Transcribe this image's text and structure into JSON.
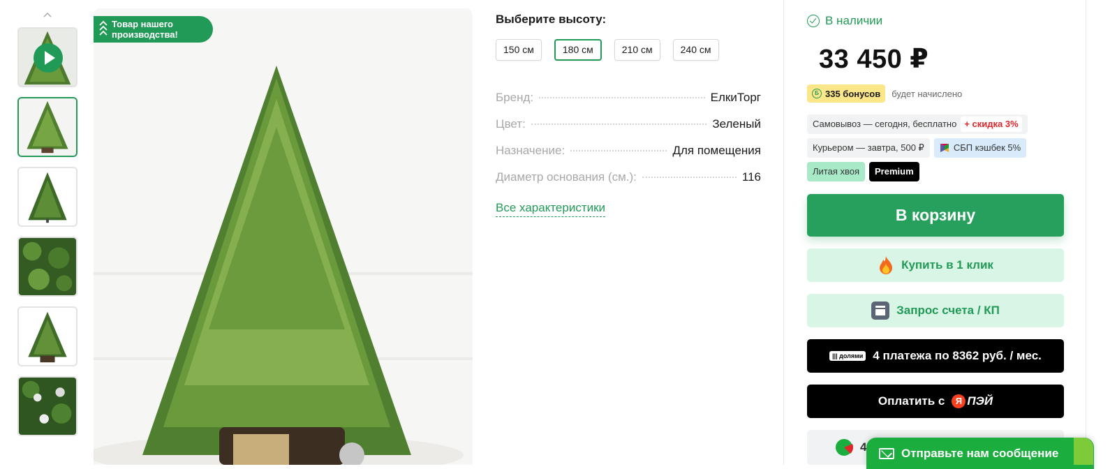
{
  "gallery": {
    "thumbnails": [
      {
        "kind": "video"
      },
      {
        "kind": "image",
        "active": true
      },
      {
        "kind": "image"
      },
      {
        "kind": "image"
      },
      {
        "kind": "image"
      },
      {
        "kind": "image"
      }
    ],
    "promo_badge": "Товар нашего\nпроизводства!"
  },
  "options": {
    "title": "Выберите высоту:",
    "sizes": [
      {
        "label": "150 см",
        "selected": false
      },
      {
        "label": "180 см",
        "selected": true
      },
      {
        "label": "210 см",
        "selected": false
      },
      {
        "label": "240 см",
        "selected": false
      }
    ]
  },
  "specs": {
    "rows": [
      {
        "label": "Бренд:",
        "value": "ЕлкиТорг"
      },
      {
        "label": "Цвет:",
        "value": "Зеленый"
      },
      {
        "label": "Назначение:",
        "value": "Для помещения"
      },
      {
        "label": "Диаметр основания (см.):",
        "value": "116"
      }
    ],
    "all_link": "Все характеристики"
  },
  "buy": {
    "stock": "В наличии",
    "price": "33 450 ₽",
    "bonus": "335 бонусов",
    "bonus_note": "будет начислено",
    "pickup": "Самовывоз — сегодня, бесплатно",
    "pickup_discount": "+ скидка 3%",
    "courier": "Курьером — завтра, 500 ₽",
    "sbp": "СБП кэшбек 5%",
    "tag_needle": "Литая хвоя",
    "tag_premium": "Premium",
    "cart": "В корзину",
    "one_click": "Купить в 1 клик",
    "invoice": "Запрос счета / КП",
    "dolyami_logo": "||| долями",
    "dolyami": "4 платежа по 8362 руб. / мес.",
    "yapay_prefix": "Оплатить с",
    "yapay_logo_letter": "Я",
    "yapay_logo_text": "ПЭЙ",
    "partial": "4"
  },
  "chat": {
    "label": "Отправьте нам сообщение"
  },
  "colors": {
    "accent": "#219a57",
    "cart": "#26a05c",
    "light_green": "#d9f5e5",
    "chat": "#1bad3d"
  }
}
